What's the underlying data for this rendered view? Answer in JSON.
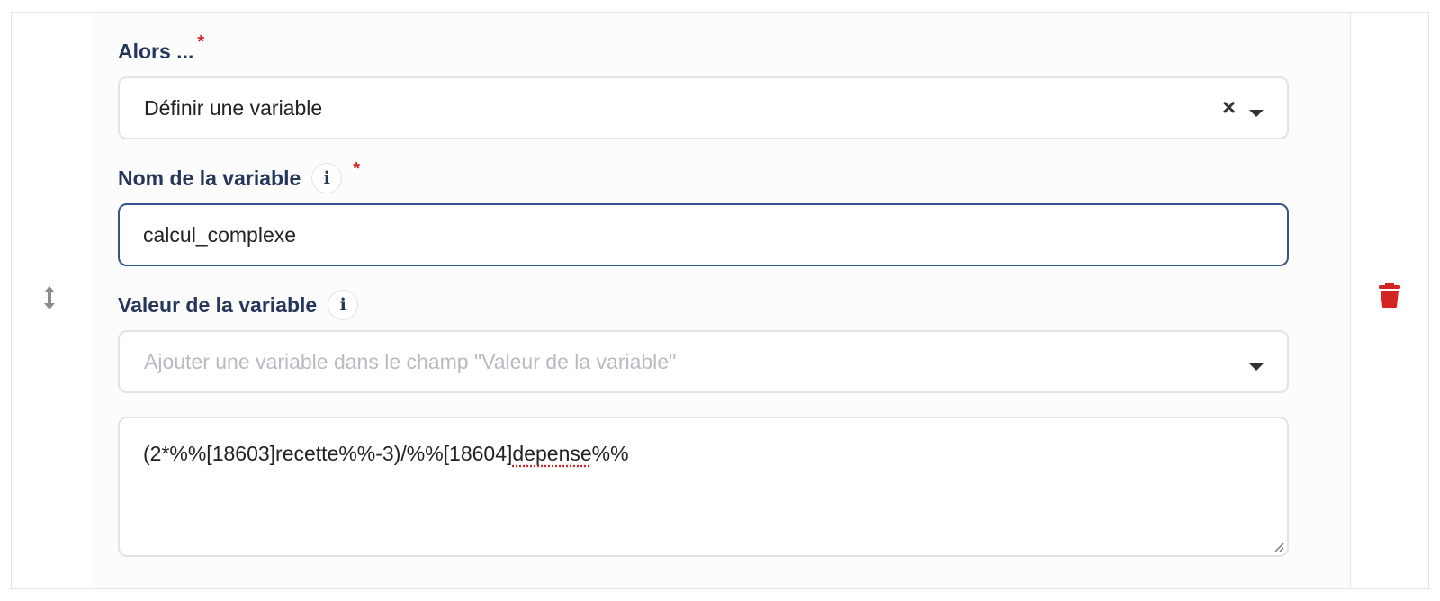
{
  "then_field": {
    "label": "Alors ...",
    "required_mark": "*",
    "selected_value": "Définir une variable",
    "clear_icon": "×",
    "dropdown_icon": "caret-down-icon"
  },
  "name_field": {
    "label": "Nom de la variable",
    "info_icon": "i",
    "required_mark": "*",
    "value": "calcul_complexe"
  },
  "value_field": {
    "label": "Valeur de la variable",
    "info_icon": "i",
    "select_placeholder": "Ajouter une variable dans le champ \"Valeur de la variable\"",
    "dropdown_icon": "caret-down-icon",
    "expression_prefix": "(2*%%[18603]recette%%-3)/%%[18604]",
    "expression_misspelled": "depense",
    "expression_suffix": "%%"
  },
  "colors": {
    "label": "#25365a",
    "required": "#d32424",
    "focus_border": "#34558b",
    "delete": "#d32424"
  }
}
